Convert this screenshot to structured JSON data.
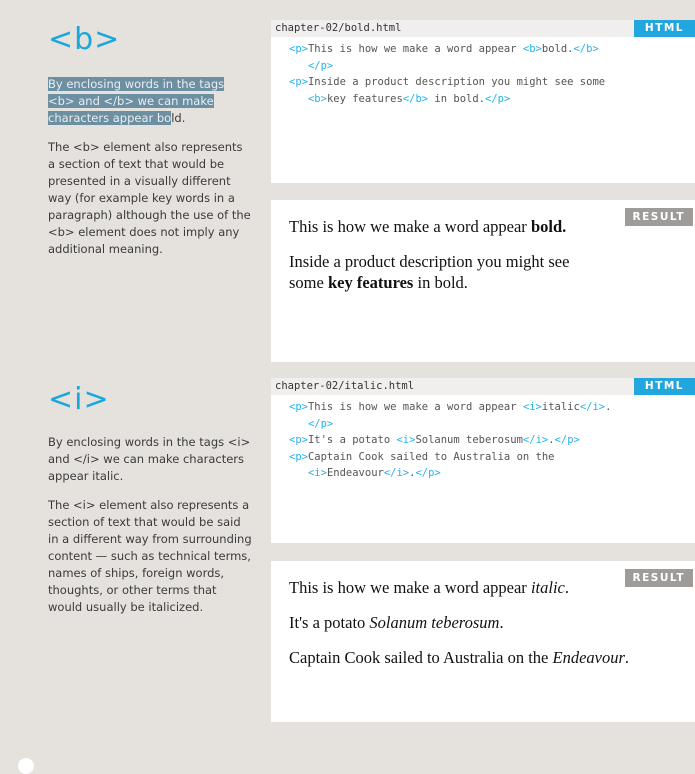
{
  "b_section": {
    "heading": "<b>",
    "para1_highlight_a": "By enclosing words in the tags",
    "para1_highlight_b": "<b> and </b> we can make",
    "para1_highlight_c": "characters appear bo",
    "para1_tail": "ld.",
    "para2": "The <b> element also represents a section of text that would be presented in a visually different way (for example key words in a paragraph) although the use of the <b> element does not imply any additional meaning.",
    "code_panel": {
      "filename": "chapter-02/bold.html",
      "badge": "HTML",
      "lines": [
        {
          "indent": "",
          "parts": [
            [
              "t",
              "<p>"
            ],
            [
              "x",
              "This is how we make a word appear "
            ],
            [
              "t",
              "<b>"
            ],
            [
              "x",
              "bold."
            ],
            [
              "t",
              "</b>"
            ]
          ]
        },
        {
          "indent": "   ",
          "parts": [
            [
              "t",
              "</p>"
            ]
          ]
        },
        {
          "indent": "",
          "parts": [
            [
              "t",
              "<p>"
            ],
            [
              "x",
              "Inside a product description you might see some"
            ]
          ]
        },
        {
          "indent": "   ",
          "parts": [
            [
              "t",
              "<b>"
            ],
            [
              "x",
              "key features"
            ],
            [
              "t",
              "</b>"
            ],
            [
              "x",
              " in bold."
            ],
            [
              "t",
              "</p>"
            ]
          ]
        }
      ]
    },
    "result_panel": {
      "badge": "RESULT",
      "p1_text": "This is how we make a word appear ",
      "p1_bold": "bold.",
      "p2_line1": "Inside a product description you might see",
      "p2_pre": "some ",
      "p2_bold": "key features",
      "p2_post": " in bold."
    }
  },
  "i_section": {
    "heading": "<i>",
    "para1": "By enclosing words in the tags <i> and </i> we can make characters appear italic.",
    "para2": "The <i> element also represents a section of text that would be said in a different way from surrounding content — such as technical terms, names of ships, foreign words, thoughts, or other terms that would usually be italicized.",
    "code_panel": {
      "filename": "chapter-02/italic.html",
      "badge": "HTML",
      "lines": [
        {
          "indent": "",
          "parts": [
            [
              "t",
              "<p>"
            ],
            [
              "x",
              "This is how we make a word appear "
            ],
            [
              "t",
              "<i>"
            ],
            [
              "x",
              "italic"
            ],
            [
              "t",
              "</i>"
            ],
            [
              "x",
              "."
            ]
          ]
        },
        {
          "indent": "   ",
          "parts": [
            [
              "t",
              "</p>"
            ]
          ]
        },
        {
          "indent": "",
          "parts": [
            [
              "t",
              "<p>"
            ],
            [
              "x",
              "It's a potato "
            ],
            [
              "t",
              "<i>"
            ],
            [
              "x",
              "Solanum teberosum"
            ],
            [
              "t",
              "</i>"
            ],
            [
              "x",
              "."
            ],
            [
              "t",
              "</p>"
            ]
          ]
        },
        {
          "indent": "",
          "parts": [
            [
              "t",
              "<p>"
            ],
            [
              "x",
              "Captain Cook sailed to Australia on the"
            ]
          ]
        },
        {
          "indent": "   ",
          "parts": [
            [
              "t",
              "<i>"
            ],
            [
              "x",
              "Endeavour"
            ],
            [
              "t",
              "</i>"
            ],
            [
              "x",
              "."
            ],
            [
              "t",
              "</p>"
            ]
          ]
        }
      ]
    },
    "result_panel": {
      "badge": "RESULT",
      "p1_text": "This is how we make a word appear ",
      "p1_italic": "italic",
      "p1_post": ".",
      "p2_text": "It's a potato ",
      "p2_italic": "Solanum teberosum",
      "p2_post": ".",
      "p3_text": "Captain Cook sailed to Australia on the ",
      "p3_italic": "Endeavour",
      "p3_post": "."
    }
  }
}
